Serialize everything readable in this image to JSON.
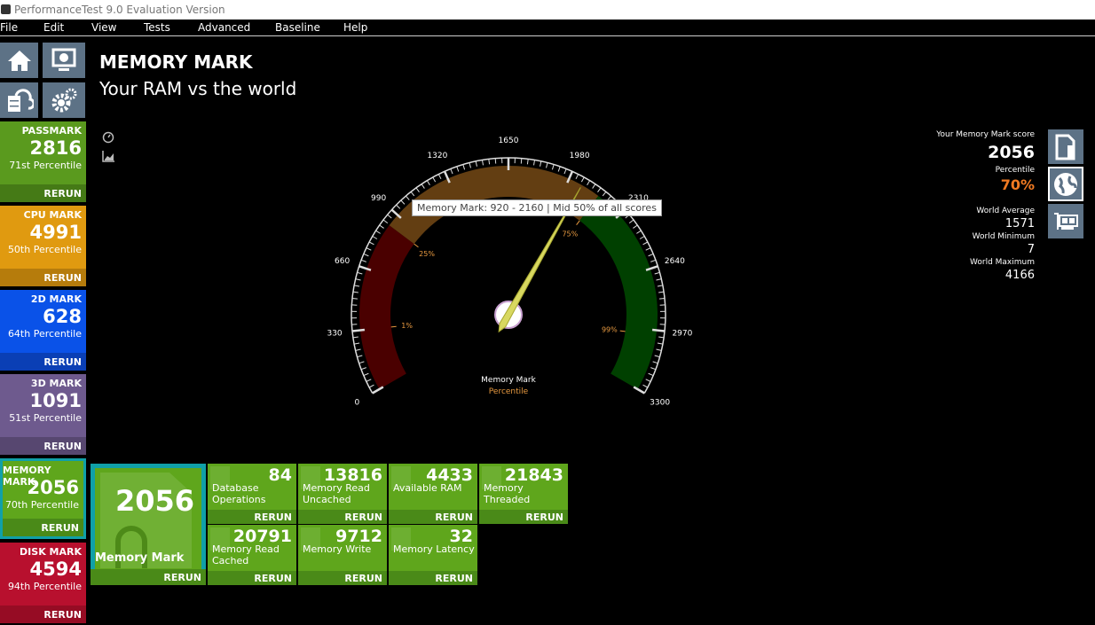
{
  "window": {
    "title": "PerformanceTest 9.0 Evaluation Version"
  },
  "menu": [
    "File",
    "Edit",
    "View",
    "Tests",
    "Advanced",
    "Baseline",
    "Help"
  ],
  "nav_icons": [
    "home-icon",
    "system-info-icon",
    "cloud-database-icon",
    "settings-gear-icon"
  ],
  "sidebar": [
    {
      "name": "PASSMARK",
      "score": "2816",
      "percentile": "71st Percentile",
      "rerun": "RERUN",
      "color": "#5a9a1e",
      "dark": "#457a16"
    },
    {
      "name": "CPU MARK",
      "score": "4991",
      "percentile": "50th Percentile",
      "rerun": "RERUN",
      "color": "#e09a10",
      "dark": "#b67c0c"
    },
    {
      "name": "2D MARK",
      "score": "628",
      "percentile": "64th Percentile",
      "rerun": "RERUN",
      "color": "#0a52e8",
      "dark": "#0a3fb5"
    },
    {
      "name": "3D MARK",
      "score": "1091",
      "percentile": "51st Percentile",
      "rerun": "RERUN",
      "color": "#6e5a8e",
      "dark": "#574770"
    },
    {
      "name": "MEMORY MARK",
      "score": "2056",
      "percentile": "70th Percentile",
      "rerun": "RERUN",
      "color": "#5fa61c",
      "dark": "#4a8a18"
    },
    {
      "name": "DISK MARK",
      "score": "4594",
      "percentile": "94th Percentile",
      "rerun": "RERUN",
      "color": "#b8102e",
      "dark": "#960c24"
    }
  ],
  "header": {
    "title": "MEMORY MARK",
    "subtitle": "Your RAM vs the world"
  },
  "summary": {
    "score_label": "Your Memory Mark score",
    "score": "2056",
    "percentile_label": "Percentile",
    "percentile": "70%",
    "avg_label": "World Average",
    "avg": "1571",
    "min_label": "World Minimum",
    "min": "7",
    "max_label": "World Maximum",
    "max": "4166",
    "accent": "#f07a22"
  },
  "side_icons": [
    "report-icon",
    "world-icon",
    "hardware-card-icon"
  ],
  "gauge": {
    "min": 0,
    "max": 3300,
    "value": 2056,
    "tick_labels": [
      "0",
      "330",
      "660",
      "990",
      "1320",
      "1650",
      "1980",
      "2310",
      "2640",
      "2970",
      "3300"
    ],
    "bands": [
      {
        "from": 0,
        "to": 920,
        "color": "#4a0000"
      },
      {
        "from": 920,
        "to": 2160,
        "color": "#633e12"
      },
      {
        "from": 2160,
        "to": 3300,
        "color": "#004000"
      }
    ],
    "percentile_marks": [
      {
        "label": "1%",
        "value": 330
      },
      {
        "label": "25%",
        "value": 920
      },
      {
        "label": "75%",
        "value": 2160
      },
      {
        "label": "99%",
        "value": 3000
      }
    ],
    "caption": "Memory Mark",
    "caption2": "Percentile",
    "tooltip": "Memory Mark: 920 - 2160 | Mid 50% of all scores"
  },
  "main_tile": {
    "score": "2056",
    "label": "Memory Mark",
    "rerun": "RERUN"
  },
  "subtests": [
    {
      "value": "84",
      "label": "Database Operations",
      "rerun": "RERUN"
    },
    {
      "value": "13816",
      "label": "Memory Read Uncached",
      "rerun": "RERUN"
    },
    {
      "value": "4433",
      "label": "Available RAM",
      "rerun": "RERUN"
    },
    {
      "value": "21843",
      "label": "Memory Threaded",
      "rerun": "RERUN"
    },
    {
      "value": "20791",
      "label": "Memory Read Cached",
      "rerun": "RERUN"
    },
    {
      "value": "9712",
      "label": "Memory Write",
      "rerun": "RERUN"
    },
    {
      "value": "32",
      "label": "Memory Latency",
      "rerun": "RERUN"
    }
  ]
}
